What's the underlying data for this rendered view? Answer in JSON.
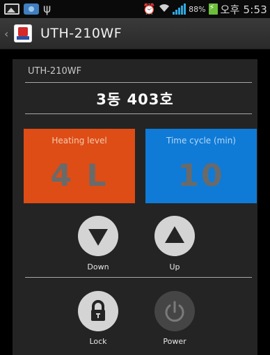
{
  "status_bar": {
    "battery_percent": "88%",
    "clock": "오후 5:53",
    "icons": [
      "gallery-icon",
      "camera-icon",
      "usb-icon",
      "alarm-icon",
      "wifi-icon",
      "signal-icon",
      "battery-charging-icon"
    ]
  },
  "action_bar": {
    "title": "UTH-210WF",
    "logo_icon": "app-logo-icon"
  },
  "panel": {
    "device_name": "UTH-210WF",
    "room": "3동 403호",
    "heating": {
      "label": "Heating level",
      "value": "4 L",
      "color": "#de4d16"
    },
    "time_cycle": {
      "label": "Time cycle (min)",
      "value": "10",
      "color": "#0f7bd6"
    },
    "buttons": {
      "down": "Down",
      "up": "Up",
      "lock": "Lock",
      "power": "Power"
    }
  }
}
